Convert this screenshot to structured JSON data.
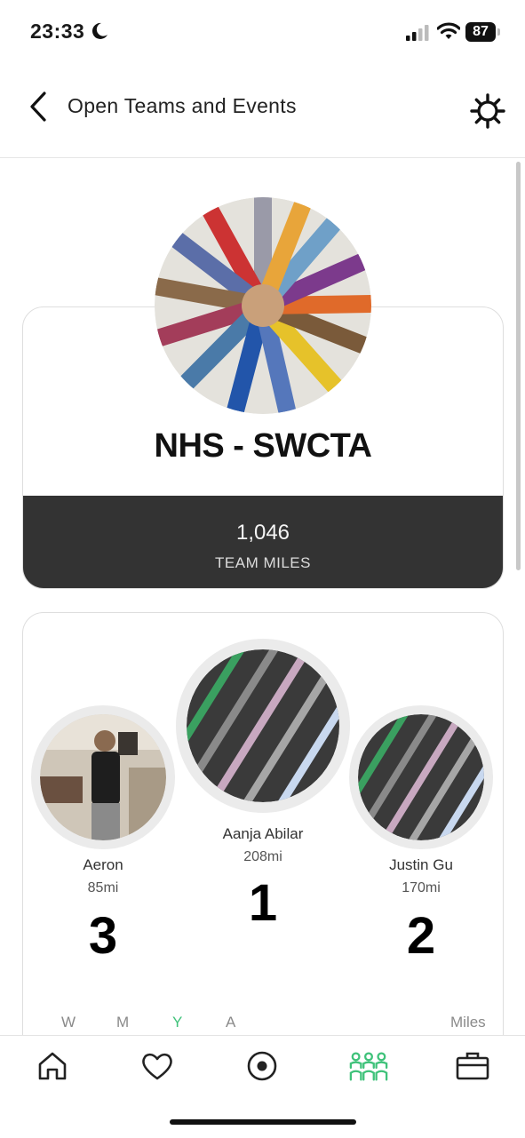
{
  "status": {
    "time": "23:33",
    "battery": "87"
  },
  "header": {
    "title": "Open Teams and Events"
  },
  "team": {
    "name": "NHS - SWCTA",
    "miles_value": "1,046",
    "miles_label": "TEAM MILES"
  },
  "leaderboard": {
    "first": {
      "name": "Aanja Abilar",
      "miles": "208mi",
      "rank": "1"
    },
    "second": {
      "name": "Justin Gu",
      "miles": "170mi",
      "rank": "2"
    },
    "third": {
      "name": "Aeron",
      "miles": "85mi",
      "rank": "3"
    }
  },
  "periods": [
    "W",
    "M",
    "Y",
    "A"
  ],
  "active_period": "Y",
  "units_label": "Miles",
  "colors": {
    "accent": "#3fc27a",
    "band": "#333333"
  },
  "tabs": [
    "home-icon",
    "heart-icon",
    "record-icon",
    "teams-icon",
    "briefcase-icon"
  ]
}
